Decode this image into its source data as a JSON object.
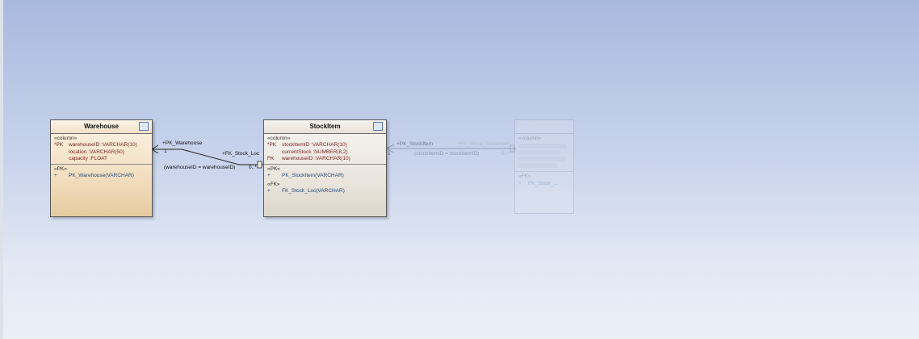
{
  "diagram": {
    "connectors": {
      "wh_stock": {
        "source_role": "+PK_Warehouse",
        "source_mult": "1",
        "target_role": "+FK_Stock_Loc",
        "target_mult": "0..*",
        "join": "(warehouseID = warehouseID)"
      },
      "stock_right": {
        "source_role": "+PK_StockItem",
        "source_mult": "1",
        "target_role": "+FK_Stock_StockItem",
        "target_mult": "0..*",
        "join": "(stockItemID = stockItemID)"
      }
    },
    "tables": {
      "warehouse": {
        "name": "Warehouse",
        "column_stereo": "«column»",
        "columns": [
          {
            "kind": "*PK",
            "name": "warehouseID",
            "type": ":VARCHAR(10)"
          },
          {
            "kind": "",
            "name": "location",
            "type": ":VARCHAR(50)"
          },
          {
            "kind": "",
            "name": "capacity",
            "type": ":FLOAT"
          }
        ],
        "pk_stereo": "«PK»",
        "pk_ops": [
          {
            "vis": "+",
            "name": "PK_Warehouse(VARCHAR)"
          }
        ]
      },
      "stockitem": {
        "name": "StockItem",
        "column_stereo": "«column»",
        "columns": [
          {
            "kind": "*PK",
            "name": "stockItemID",
            "type": ":VARCHAR(10)"
          },
          {
            "kind": "",
            "name": "currentStock",
            "type": ":NUMBER(8,2)"
          },
          {
            "kind": "FK",
            "name": "warehouseID",
            "type": ":VARCHAR(10)"
          }
        ],
        "pk_stereo": "«PK»",
        "pk_ops": [
          {
            "vis": "+",
            "name": "PK_StockItem(VARCHAR)"
          }
        ],
        "fk_stereo": "«FK»",
        "fk_ops": [
          {
            "vis": "+",
            "name": "FK_Stock_Loc(VARCHAR)"
          }
        ]
      },
      "faded": {
        "name": "",
        "column_stereo": "«column»",
        "fk_stereo": "«FK»",
        "fk_ops": [
          {
            "vis": "+",
            "name": "FK_Stock_..."
          }
        ]
      }
    }
  }
}
